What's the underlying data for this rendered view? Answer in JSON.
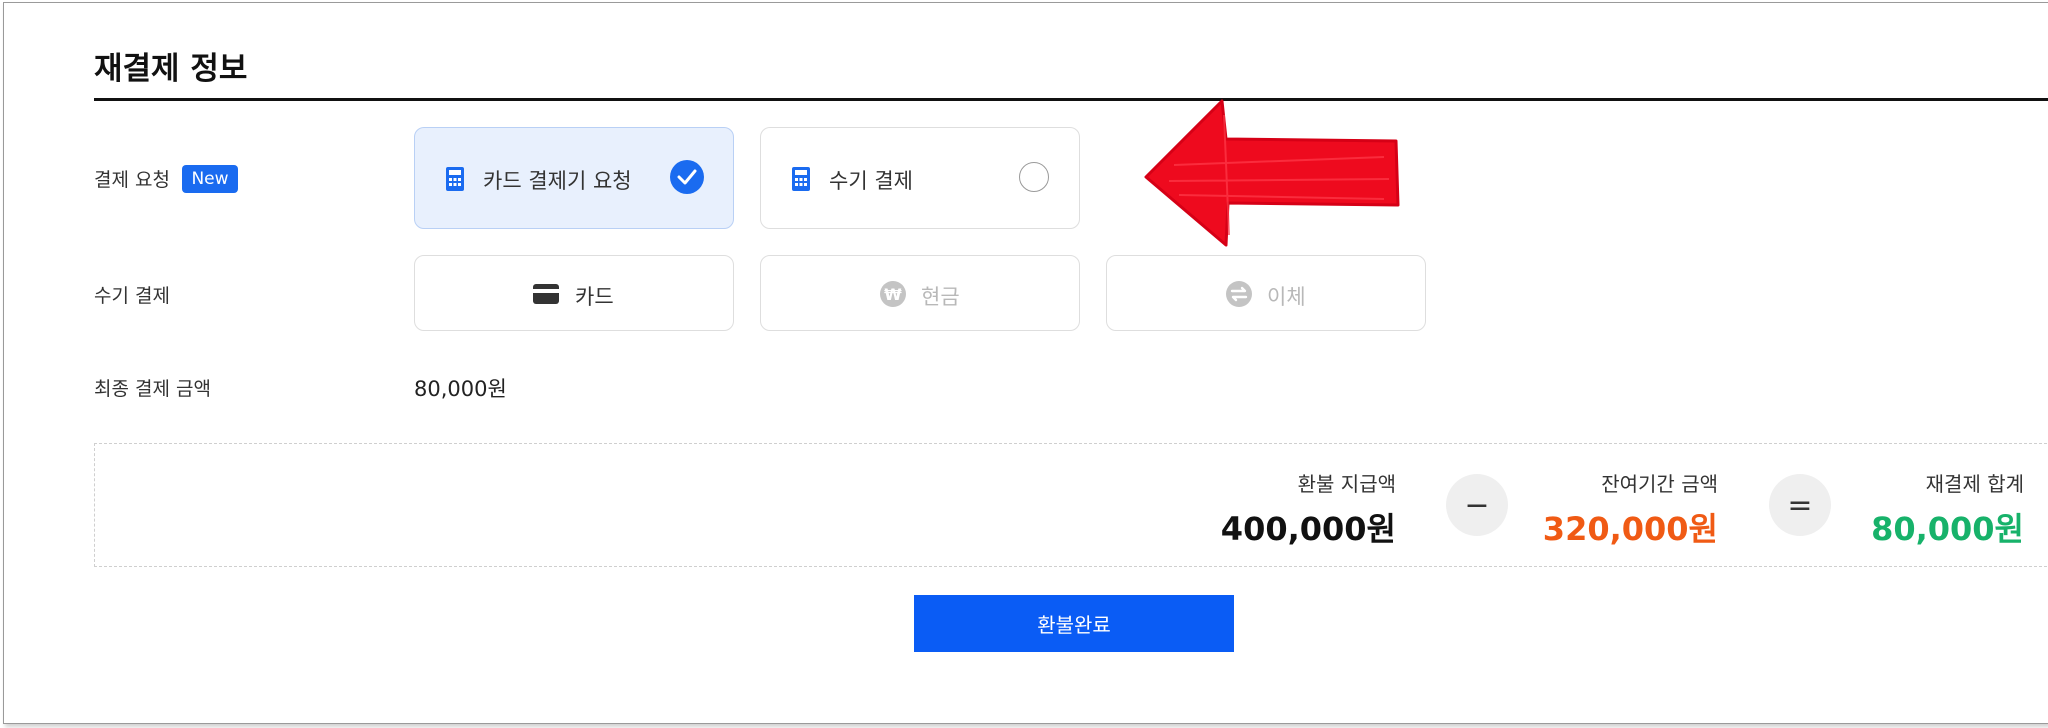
{
  "section": {
    "title": "재결제 정보"
  },
  "payment_request": {
    "label": "결제 요청",
    "badge": "New",
    "options": [
      {
        "label": "카드 결제기 요청",
        "icon": "calculator-icon",
        "selected": true
      },
      {
        "label": "수기 결제",
        "icon": "calculator-icon",
        "selected": false
      }
    ]
  },
  "manual_payment": {
    "label": "수기 결제",
    "options": [
      {
        "label": "카드",
        "icon": "card-icon",
        "enabled": true
      },
      {
        "label": "현금",
        "icon": "won-icon",
        "enabled": false
      },
      {
        "label": "이체",
        "icon": "transfer-icon",
        "enabled": false
      }
    ]
  },
  "final_amount": {
    "label": "최종 결제 금액",
    "value": "80,000원"
  },
  "summary": {
    "refund": {
      "label": "환불 지급액",
      "value": "400,000원",
      "color": "#111111"
    },
    "minus_symbol": "−",
    "remaining": {
      "label": "잔여기간 금액",
      "value": "320,000원",
      "color": "#f05a14"
    },
    "equals_symbol": "=",
    "total": {
      "label": "재결제 합계",
      "value": "80,000원",
      "color": "#17b26a"
    }
  },
  "submit_button": {
    "label": "환불완료"
  },
  "colors": {
    "accent": "#1a6bf0",
    "annotation_arrow": "#ee0a1e"
  }
}
